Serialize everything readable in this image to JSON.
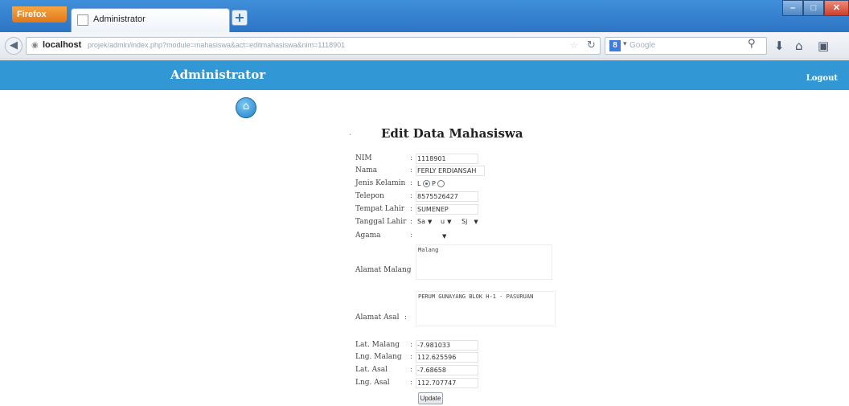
{
  "browser": {
    "app_button": "Firefox",
    "tab_title": "Administrator",
    "new_tab": "+",
    "url_host": "localhost",
    "url_path": "projek/admin/index.php?module=mahasiswa&act=editmahasiswa&nim=1118901",
    "search_engine": "8",
    "search_placeholder": "Google",
    "icons": [
      "back-icon",
      "reload-icon",
      "search-icon",
      "download-icon",
      "home-icon",
      "bookmark-icon"
    ]
  },
  "header": {
    "title": "Administrator",
    "logout": "Logout",
    "color": "#3298d5"
  },
  "form": {
    "title": "Edit Data Mahasiswa",
    "fields": {
      "nim": {
        "label": "NIM",
        "value": "1118901"
      },
      "nama": {
        "label": "Nama",
        "value": "FERLY ERDIANSAH"
      },
      "jenis_kelamin": {
        "label": "Jenis Kelamin",
        "option_l": "L",
        "option_p": "P",
        "selected": "L"
      },
      "telepon": {
        "label": "Telepon",
        "value": "8575526427"
      },
      "tempat_lahir": {
        "label": "Tempat Lahir",
        "value": "SUMENEP"
      },
      "tanggal_lahir": {
        "label": "Tanggal Lahir",
        "day": "Sa",
        "month": "u",
        "year": "Sj"
      },
      "agama": {
        "label": "Agama",
        "value": ""
      },
      "alamat_malang": {
        "label": "Alamat Malang",
        "value": "Malang"
      },
      "alamat_asal": {
        "label": "Alamat Asal",
        "value": "PERUM GUNAYANG BLOK H-1 - PASURUAN"
      },
      "lat_malang": {
        "label": "Lat. Malang",
        "value": "-7.981033"
      },
      "lng_malang": {
        "label": "Lng. Malang",
        "value": "112.625596"
      },
      "lat_asal": {
        "label": "Lat. Asal",
        "value": "-7.68658"
      },
      "lng_asal": {
        "label": "Lng. Asal",
        "value": "112.707747"
      }
    },
    "colon": ":",
    "submit": "Update"
  }
}
